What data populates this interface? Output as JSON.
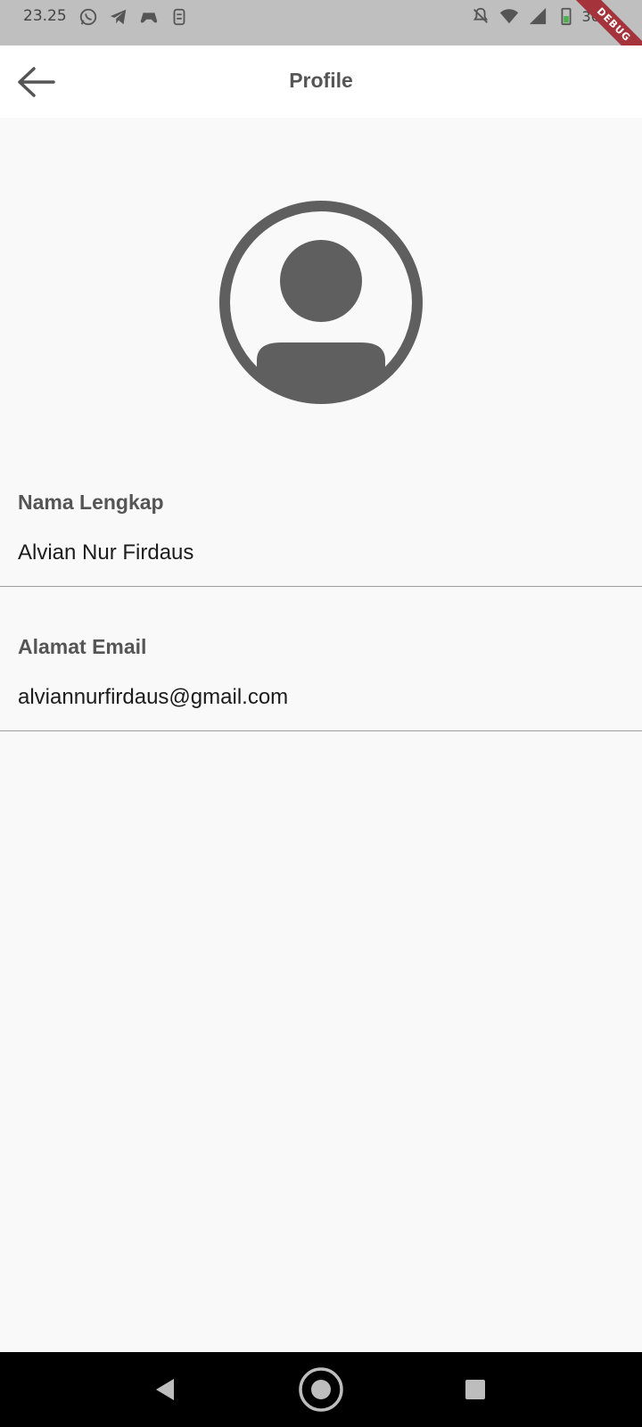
{
  "status_bar": {
    "time": "23.25",
    "battery": "36%",
    "left_icons": [
      "whatsapp-icon",
      "telegram-icon",
      "game-controller-icon",
      "notification-icon"
    ],
    "right_icons": [
      "mute-icon",
      "wifi-icon",
      "signal-icon",
      "battery-icon"
    ]
  },
  "debug_badge": "DEBUG",
  "app_bar": {
    "title": "Profile",
    "back_icon": "arrow-left-icon"
  },
  "avatar": {
    "icon": "account-circle-icon",
    "color": "#5f5f5f"
  },
  "profile": {
    "full_name_label": "Nama Lengkap",
    "full_name_value": "Alvian Nur Firdaus",
    "email_label": "Alamat Email",
    "email_value": "alviannurfirdaus@gmail.com"
  },
  "nav_bar": {
    "back_icon": "nav-back-icon",
    "home_icon": "nav-home-icon",
    "recents_icon": "nav-recents-icon"
  },
  "colors": {
    "status_bar_bg": "#bfbfbf",
    "app_bar_bg": "#ffffff",
    "page_bg": "#f9f9f9",
    "text_muted": "#555555",
    "debug_ribbon": "#a5333b"
  }
}
